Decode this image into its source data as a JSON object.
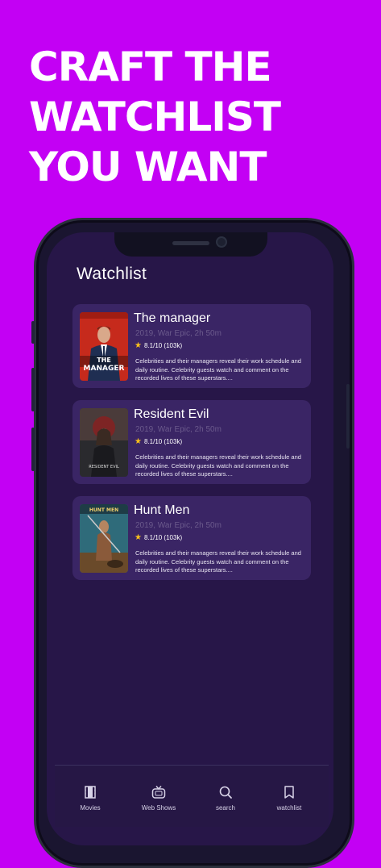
{
  "headline": {
    "lines": [
      "CRAFT THE",
      "WATCHLIST",
      "YOU WANT"
    ]
  },
  "screen": {
    "title": "Watchlist"
  },
  "watchlist": [
    {
      "title": "The manager",
      "meta": "2019, War Epic, 2h 50m",
      "rating": "8.1/10 (103k)",
      "description": "Celebrities and their managers reveal their work schedule and daily routine. Celebrity guests watch and comment on the recorded lives of these superstars....",
      "poster_text": "THE MANAGER"
    },
    {
      "title": "Resident Evil",
      "meta": "2019, War Epic, 2h 50m",
      "rating": "8.1/10 (103k)",
      "description": "Celebrities and their managers reveal their work schedule and daily routine. Celebrity guests watch and comment on the recorded lives of these superstars....",
      "poster_text": "RESIDENT EVIL"
    },
    {
      "title": "Hunt Men",
      "meta": "2019, War Epic, 2h 50m",
      "rating": "8.1/10 (103k)",
      "description": "Celebrities and their managers reveal their work schedule and daily routine. Celebrity guests watch and comment on the recorded lives of these superstars....",
      "poster_text": "HUNT MEN"
    }
  ],
  "tabs": [
    {
      "label": "Movies",
      "icon": "film-icon"
    },
    {
      "label": "Web Shows",
      "icon": "tv-icon"
    },
    {
      "label": "search",
      "icon": "search-icon"
    },
    {
      "label": "watchlist",
      "icon": "bookmark-icon"
    }
  ],
  "colors": {
    "background": "#c300f4",
    "screen": "#271648",
    "card": "#3a2565",
    "star": "#ffc21a"
  }
}
